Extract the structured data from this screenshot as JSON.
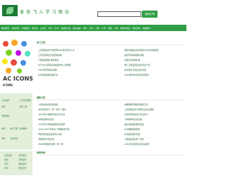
{
  "header": {
    "logo_text": "爱 放 飞 入 学 习 网 站",
    "search_placeholder": "",
    "search_button": "搜索文章"
  },
  "nav": {
    "items": [
      "网站首页",
      "高职高专",
      "高职单招",
      "研究生",
      "公务员",
      "中考",
      "高考",
      "英语四六级",
      "职业资格",
      "初中",
      "高中",
      "日语",
      "大学",
      "韩语",
      "小学",
      "教师资格证",
      "软件测试",
      "电脑知识"
    ]
  },
  "sidebar": {
    "banner_text": "AC ICONS",
    "banner_sub": "ICONS",
    "panel_rows": [
      {
        "a": "工作总结",
        "b": "入门实习报告"
      },
      {
        "a": "中考",
        "b": "中考二本"
      },
      {
        "a": "考研资料",
        "b": ""
      },
      {
        "a": "中考",
        "b": "中考下册"
      },
      {
        "a": "中考",
        "b": "高中期中"
      },
      {
        "a": "中考",
        "b": "高中考试"
      }
    ],
    "panel2_rows": [
      {
        "a": "正式合同",
        "b": "合同合同"
      },
      {
        "a": "发票",
        "b": "订制合同"
      },
      {
        "a": "合同",
        "b": "采购合同"
      },
      {
        "a": "合同",
        "b": "劳务合同"
      }
    ]
  },
  "sections": {
    "hot_title": "热门文章",
    "hot_links_left": [
      "上海应用技术大学招聘2024年高层次人才",
      "江苏省选调生考试招聘启事",
      "下册快捷刷题-教材答案",
      "关于2024届专接本校区学生入学通知",
      "2024年新年的演讲稿",
      "高考英语各类短语汇总"
    ],
    "hot_links_right": [
      "湖南高等职业技术学院2024年单独招生",
      "最新专科院校报名通知",
      "高职高专院校名单",
      "电气工程及其自动化专业介绍",
      "初中语文全部古诗文总结",
      "2024届学生毕业鉴定表范文"
    ],
    "latest_title": "最新文章",
    "latest_links_left": [
      "小学生语文阅读训练题",
      "中考化学复习（第一单元）课件",
      "2024年高中数学学业水平考试",
      "中学英语作文范文",
      "2024年大学英语四级考试真题",
      "2024-2025 学年第一学期教学计划",
      "年级学生综合素质评价方案",
      "学期安排计划表格",
      "2024年期末考试卷（第一套）"
    ],
    "latest_links_right": [
      "中级职称评审答辩题目汇总",
      "上海应用技术大学研究生复试通知",
      "高中历史学业水平考试复习",
      "小学数学知识点归纳",
      "事业单位面试题及答案",
      "高中物理选修课件",
      "初中语文课外阅读",
      "人教版英语必修一课文",
      "2024年高校毕业生就业指导"
    ],
    "recommend_title": "推荐阅读"
  },
  "colors": {
    "brand": "#2f9e44",
    "panel": "#e3eedb",
    "link": "#1a5c2a"
  }
}
